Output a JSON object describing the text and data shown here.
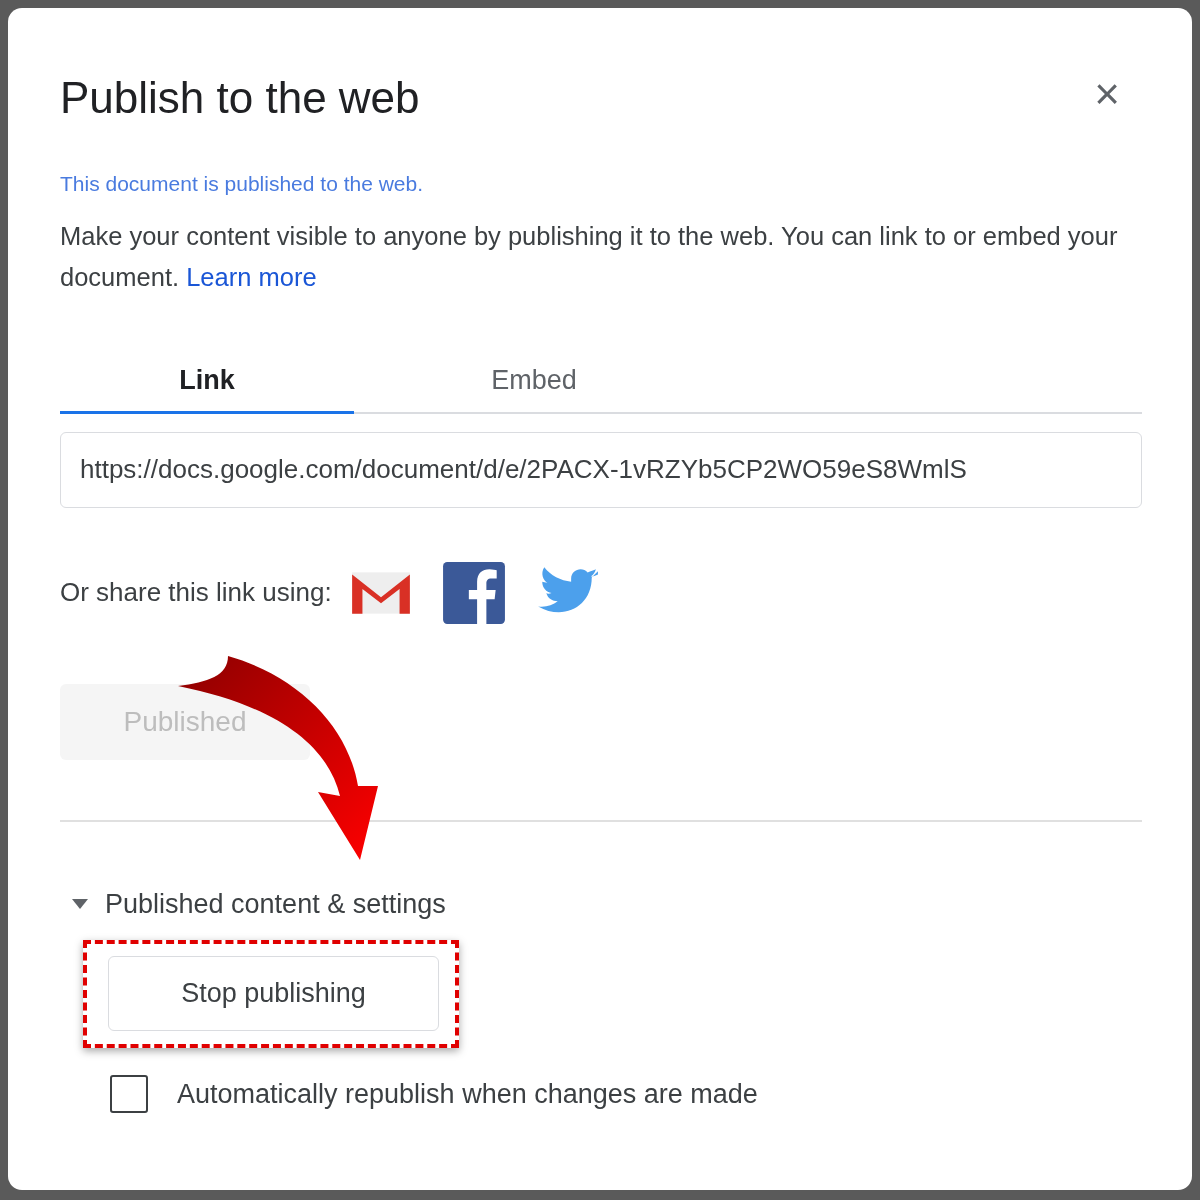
{
  "dialog": {
    "title": "Publish to the web",
    "close": "×"
  },
  "status": "This document is published to the web.",
  "description": {
    "text": "Make your content visible to anyone by publishing it to the web. You can link to or embed your document.",
    "link": "Learn more"
  },
  "tabs": [
    {
      "label": "Link",
      "selected": true
    },
    {
      "label": "Embed",
      "selected": false
    }
  ],
  "link_field": {
    "value": "https://docs.google.com/document/d/e/2PACX-1vRZYb5CP2WO59eS8WmlS"
  },
  "share": {
    "label": "Or share this link using:",
    "services": [
      {
        "kind": "gmail"
      },
      {
        "kind": "facebook"
      },
      {
        "kind": "twitter"
      }
    ]
  },
  "publish_button": {
    "label": "Published",
    "disabled": true
  },
  "settings": {
    "label": "Published content & settings",
    "expanded": true,
    "stop_button": {
      "label": "Stop publishing"
    },
    "auto_republish": {
      "label": "Automatically republish when changes are made",
      "checked": false
    }
  }
}
